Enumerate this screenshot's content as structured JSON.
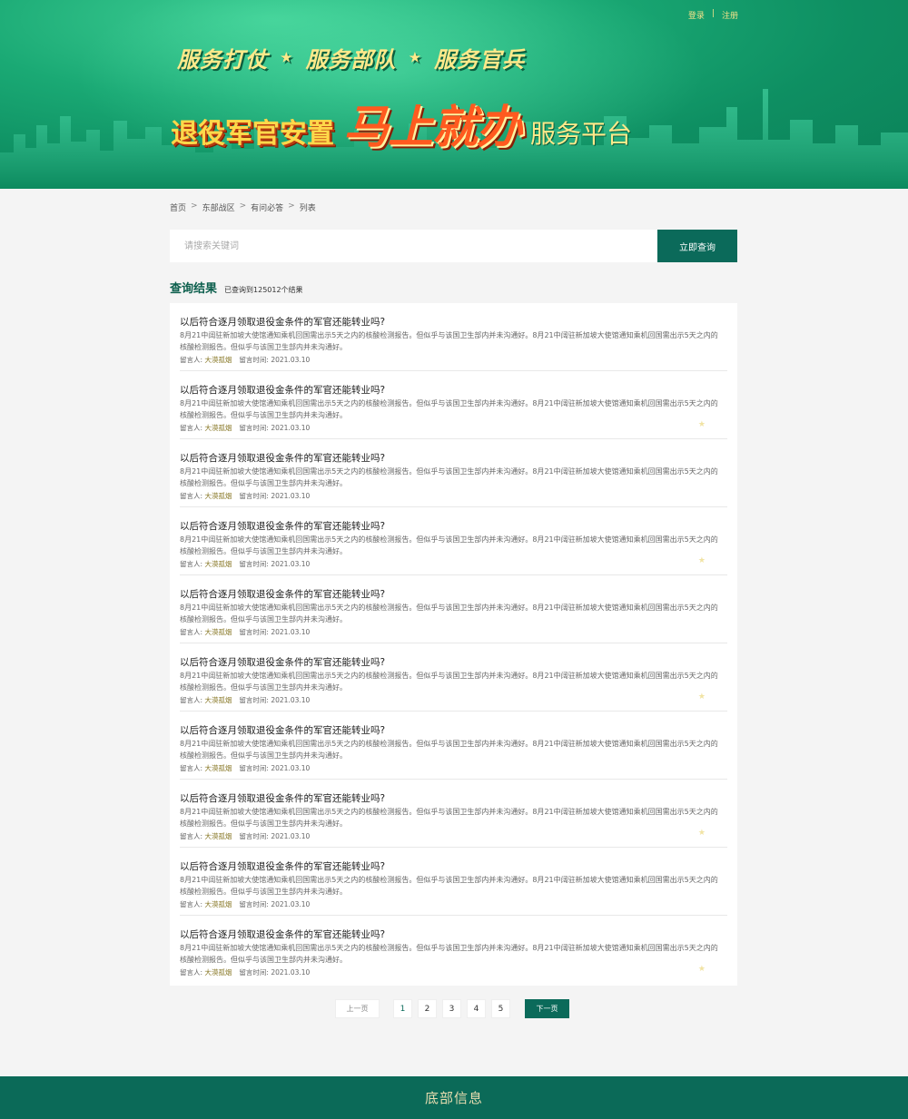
{
  "header": {
    "login": "登录",
    "separator": "|",
    "register": "注册",
    "slogan": [
      "服务打仗",
      "服务部队",
      "服务官兵"
    ],
    "slogan_star": "★",
    "title_part1": "退役军官安置",
    "title_part2": "马上就办",
    "title_part3": "服务平台"
  },
  "breadcrumb": {
    "items": [
      "首页",
      "东部战区",
      "有问必答",
      "列表"
    ],
    "separator": ">"
  },
  "search": {
    "placeholder": "请搜索关键词",
    "button_label": "立即查询"
  },
  "results": {
    "label": "查询结果",
    "count_text": "已查询到125012个结果",
    "items": [
      {
        "question": "以后符合逐月领取退役金条件的军官还能转业吗?",
        "answer": "8月21中阔驻新加坡大使馆通知乘机回国需出示5天之内的核酸检测报告。但似乎与该国卫生部内并未沟通好。8月21中阔驻新加坡大使馆通知乘机回国需出示5天之内的核酸检测报告。但似乎与该国卫生部内并未沟通好。",
        "author_label": "留言人:",
        "author": "大漠孤烟",
        "time_label": "留言时间:",
        "time": "2021.03.10",
        "starred": false
      },
      {
        "question": "以后符合逐月领取退役金条件的军官还能转业吗?",
        "answer": "8月21中阔驻新加坡大使馆通知乘机回国需出示5天之内的核酸检测报告。但似乎与该国卫生部内并未沟通好。8月21中阔驻新加坡大使馆通知乘机回国需出示5天之内的核酸检测报告。但似乎与该国卫生部内并未沟通好。",
        "author_label": "留言人:",
        "author": "大漠孤烟",
        "time_label": "留言时间:",
        "time": "2021.03.10",
        "starred": true
      },
      {
        "question": "以后符合逐月领取退役金条件的军官还能转业吗?",
        "answer": "8月21中阔驻新加坡大使馆通知乘机回国需出示5天之内的核酸检测报告。但似乎与该国卫生部内并未沟通好。8月21中阔驻新加坡大使馆通知乘机回国需出示5天之内的核酸检测报告。但似乎与该国卫生部内并未沟通好。",
        "author_label": "留言人:",
        "author": "大漠孤烟",
        "time_label": "留言时间:",
        "time": "2021.03.10",
        "starred": false
      },
      {
        "question": "以后符合逐月领取退役金条件的军官还能转业吗?",
        "answer": "8月21中阔驻新加坡大使馆通知乘机回国需出示5天之内的核酸检测报告。但似乎与该国卫生部内并未沟通好。8月21中阔驻新加坡大使馆通知乘机回国需出示5天之内的核酸检测报告。但似乎与该国卫生部内并未沟通好。",
        "author_label": "留言人:",
        "author": "大漠孤烟",
        "time_label": "留言时间:",
        "time": "2021.03.10",
        "starred": true
      },
      {
        "question": "以后符合逐月领取退役金条件的军官还能转业吗?",
        "answer": "8月21中阔驻新加坡大使馆通知乘机回国需出示5天之内的核酸检测报告。但似乎与该国卫生部内并未沟通好。8月21中阔驻新加坡大使馆通知乘机回国需出示5天之内的核酸检测报告。但似乎与该国卫生部内并未沟通好。",
        "author_label": "留言人:",
        "author": "大漠孤烟",
        "time_label": "留言时间:",
        "time": "2021.03.10",
        "starred": false
      },
      {
        "question": "以后符合逐月领取退役金条件的军官还能转业吗?",
        "answer": "8月21中阔驻新加坡大使馆通知乘机回国需出示5天之内的核酸检测报告。但似乎与该国卫生部内并未沟通好。8月21中阔驻新加坡大使馆通知乘机回国需出示5天之内的核酸检测报告。但似乎与该国卫生部内并未沟通好。",
        "author_label": "留言人:",
        "author": "大漠孤烟",
        "time_label": "留言时间:",
        "time": "2021.03.10",
        "starred": true
      },
      {
        "question": "以后符合逐月领取退役金条件的军官还能转业吗?",
        "answer": "8月21中阔驻新加坡大使馆通知乘机回国需出示5天之内的核酸检测报告。但似乎与该国卫生部内并未沟通好。8月21中阔驻新加坡大使馆通知乘机回国需出示5天之内的核酸检测报告。但似乎与该国卫生部内并未沟通好。",
        "author_label": "留言人:",
        "author": "大漠孤烟",
        "time_label": "留言时间:",
        "time": "2021.03.10",
        "starred": false
      },
      {
        "question": "以后符合逐月领取退役金条件的军官还能转业吗?",
        "answer": "8月21中阔驻新加坡大使馆通知乘机回国需出示5天之内的核酸检测报告。但似乎与该国卫生部内并未沟通好。8月21中阔驻新加坡大使馆通知乘机回国需出示5天之内的核酸检测报告。但似乎与该国卫生部内并未沟通好。",
        "author_label": "留言人:",
        "author": "大漠孤烟",
        "time_label": "留言时间:",
        "time": "2021.03.10",
        "starred": true
      },
      {
        "question": "以后符合逐月领取退役金条件的军官还能转业吗?",
        "answer": "8月21中阔驻新加坡大使馆通知乘机回国需出示5天之内的核酸检测报告。但似乎与该国卫生部内并未沟通好。8月21中阔驻新加坡大使馆通知乘机回国需出示5天之内的核酸检测报告。但似乎与该国卫生部内并未沟通好。",
        "author_label": "留言人:",
        "author": "大漠孤烟",
        "time_label": "留言时间:",
        "time": "2021.03.10",
        "starred": false
      },
      {
        "question": "以后符合逐月领取退役金条件的军官还能转业吗?",
        "answer": "8月21中阔驻新加坡大使馆通知乘机回国需出示5天之内的核酸检测报告。但似乎与该国卫生部内并未沟通好。8月21中阔驻新加坡大使馆通知乘机回国需出示5天之内的核酸检测报告。但似乎与该国卫生部内并未沟通好。",
        "author_label": "留言人:",
        "author": "大漠孤烟",
        "time_label": "留言时间:",
        "time": "2021.03.10",
        "starred": true
      }
    ]
  },
  "pagination": {
    "prev_label": "上一页",
    "pages": [
      "1",
      "2",
      "3",
      "4",
      "5"
    ],
    "current_page": "1",
    "next_label": "下一页"
  },
  "footer": {
    "text": "底部信息"
  },
  "colors": {
    "primary": "#0b6a5a",
    "banner_green": "#1aa974",
    "footer_bg": "#0b6a58"
  }
}
